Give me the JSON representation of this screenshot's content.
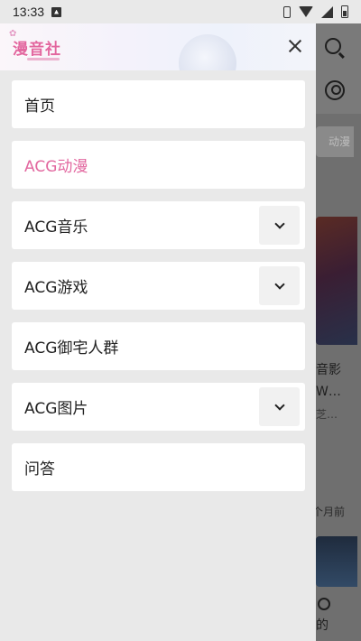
{
  "status_bar": {
    "time": "13:33",
    "icons": [
      "app-notification-icon",
      "phone-icon",
      "wifi-icon",
      "signal-icon",
      "battery-icon"
    ]
  },
  "drawer": {
    "logo_text": "漫音社",
    "close_icon": "close-icon",
    "accent_color": "#e2679f",
    "menu": [
      {
        "label": "首页",
        "active": false,
        "expandable": false
      },
      {
        "label": "ACG动漫",
        "active": true,
        "expandable": false
      },
      {
        "label": "ACG音乐",
        "active": false,
        "expandable": true
      },
      {
        "label": "ACG游戏",
        "active": false,
        "expandable": true
      },
      {
        "label": "ACG御宅人群",
        "active": false,
        "expandable": false
      },
      {
        "label": "ACG图片",
        "active": false,
        "expandable": true
      },
      {
        "label": "问答",
        "active": false,
        "expandable": false
      }
    ]
  },
  "background": {
    "tab_label": "动漫",
    "card_title": "音影\nW…",
    "card_sub": "芝…",
    "time_label": "个月前",
    "card2_title": "的"
  }
}
